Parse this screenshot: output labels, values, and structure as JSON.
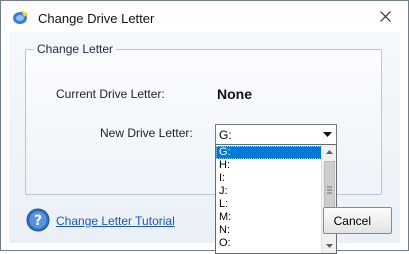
{
  "window": {
    "title": "Change Drive Letter",
    "close_icon": "close-icon",
    "app_icon": "partition-wizard-icon"
  },
  "group": {
    "title": "Change Letter",
    "current_label": "Current Drive Letter:",
    "current_value": "None",
    "new_label": "New Drive Letter:"
  },
  "combo": {
    "selected": "G:",
    "options": [
      "G:",
      "H:",
      "I:",
      "J:",
      "L:",
      "M:",
      "N:",
      "O:"
    ]
  },
  "footer": {
    "tutorial_link": "Change Letter Tutorial",
    "cancel_label": "Cancel"
  },
  "colors": {
    "selection": "#0078d7",
    "link": "#1a56c9"
  }
}
